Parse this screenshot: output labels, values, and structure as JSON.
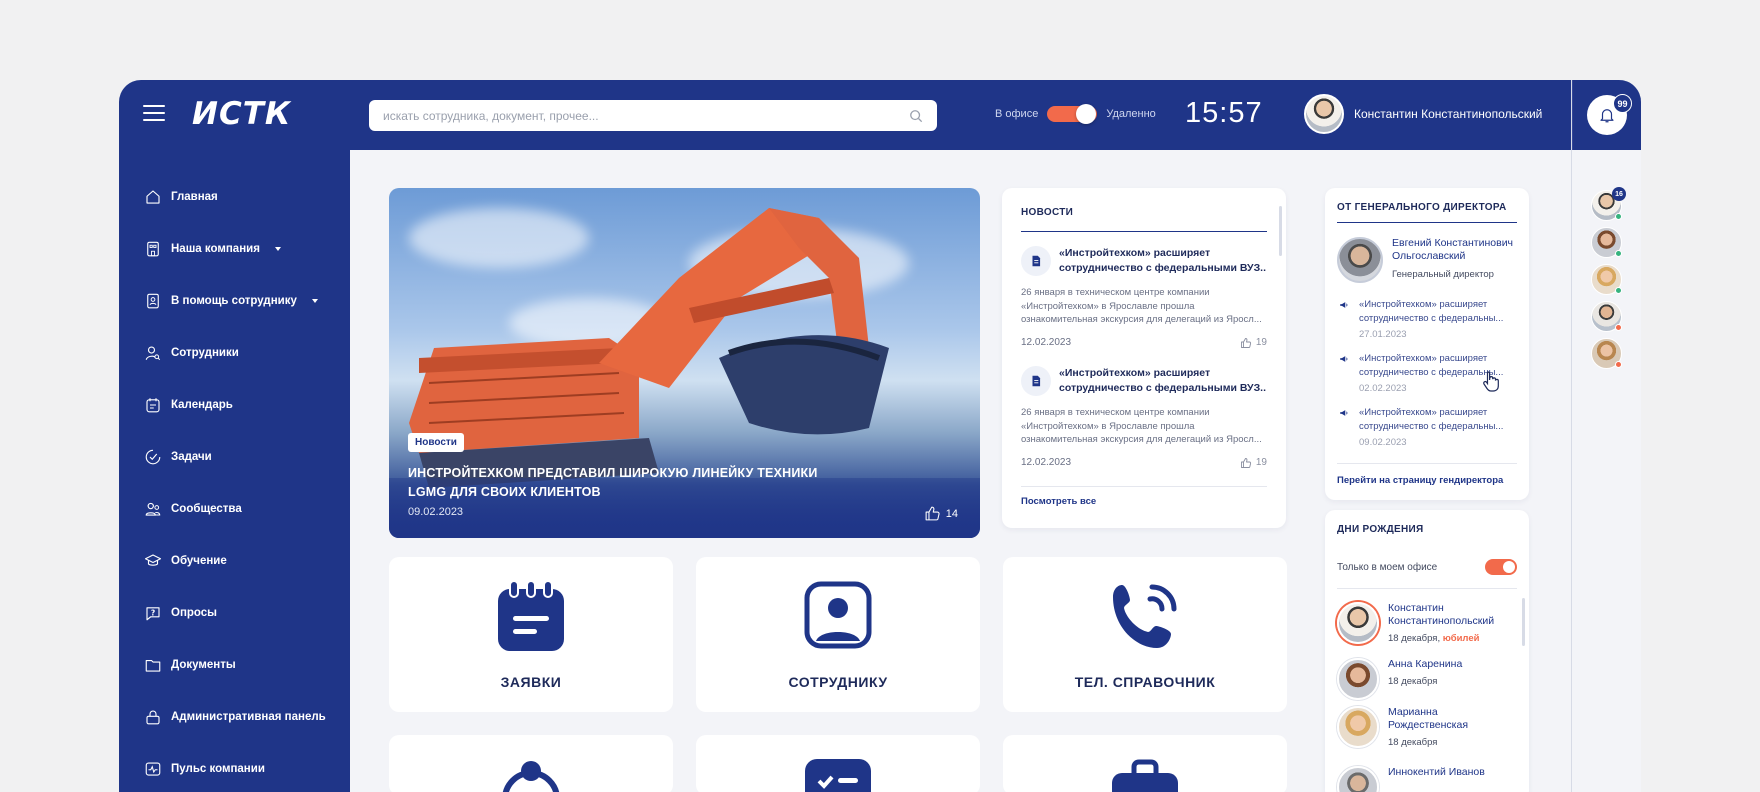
{
  "header": {
    "logo": "ИСТК",
    "search_placeholder": "искать сотрудника, документ, прочее...",
    "mode_office": "В офисе",
    "mode_remote": "Удаленно",
    "time": "15:57",
    "user_name": "Константин Константинопольский",
    "notifications_count": "99"
  },
  "sidebar": {
    "items": [
      {
        "label": "Главная",
        "icon": "home-icon"
      },
      {
        "label": "Наша компания",
        "icon": "building-icon",
        "dropdown": true
      },
      {
        "label": "В помощь сотруднику",
        "icon": "help-badge-icon",
        "dropdown": true
      },
      {
        "label": "Сотрудники",
        "icon": "user-search-icon"
      },
      {
        "label": "Календарь",
        "icon": "calendar-icon"
      },
      {
        "label": "Задачи",
        "icon": "tasks-icon"
      },
      {
        "label": "Сообщества",
        "icon": "community-icon"
      },
      {
        "label": "Обучение",
        "icon": "graduation-icon"
      },
      {
        "label": "Опросы",
        "icon": "poll-icon"
      },
      {
        "label": "Документы",
        "icon": "folder-icon"
      },
      {
        "label": "Административная панель",
        "icon": "lock-icon"
      },
      {
        "label": "Пульс компании",
        "icon": "pulse-icon"
      }
    ]
  },
  "hero": {
    "badge": "Новости",
    "title": "ИНСТРОЙТЕХКОМ ПРЕДСТАВИЛ ШИРОКУЮ ЛИНЕЙКУ ТЕХНИКИ LGMG ДЛЯ СВОИХ КЛИЕНТОВ",
    "date": "09.02.2023",
    "likes": "14"
  },
  "news": {
    "title": "НОВОСТИ",
    "items": [
      {
        "headline": "«Инстройтехком» расширяет сотрудничество с федеральными ВУЗ..",
        "body": "26 января в техническом центре компании «Инстройтехком» в Ярославле прошла ознакомительная экскурсия для делегаций из Яросл...",
        "date": "12.02.2023",
        "likes": "19"
      },
      {
        "headline": "«Инстройтехком» расширяет сотрудничество с федеральными ВУЗ..",
        "body": "26 января в техническом центре компании «Инстройтехком» в Ярославле прошла ознакомительная экскурсия для делегаций из Яросл...",
        "date": "12.02.2023",
        "likes": "19"
      }
    ],
    "view_all": "Посмотреть все"
  },
  "tiles": [
    {
      "label": "ЗАЯВКИ",
      "icon": "request-notepad-icon"
    },
    {
      "label": "СОТРУДНИКУ",
      "icon": "employee-portrait-icon"
    },
    {
      "label": "ТЕЛ. СПРАВОЧНИК",
      "icon": "phone-icon"
    }
  ],
  "director": {
    "title": "ОТ ГЕНЕРАЛЬНОГО ДИРЕКТОРА",
    "name": "Евгений Константинович Ольгославский",
    "role": "Генеральный директор",
    "messages": [
      {
        "text": "«Инстройтехком» расширяет сотрудничество с федеральны...",
        "date": "27.01.2023"
      },
      {
        "text": "«Инстройтехком» расширяет сотрудничество с федеральны...",
        "date": "02.02.2023"
      },
      {
        "text": "«Инстройтехком» расширяет сотрудничество с федеральны...",
        "date": "09.02.2023"
      }
    ],
    "link": "Перейти на страницу гендиректора"
  },
  "birthdays": {
    "title": "ДНИ РОЖДЕНИЯ",
    "filter_label": "Только в моем офисе",
    "items": [
      {
        "name": "Константин Константинопольский",
        "date": "18 декабря,",
        "tag": "юбилей"
      },
      {
        "name": "Анна Каренина",
        "date": "18 декабря",
        "tag": ""
      },
      {
        "name": "Марианна Рождественская",
        "date": "18 декабря",
        "tag": ""
      },
      {
        "name": "Иннокентий Иванов",
        "date": "",
        "tag": ""
      }
    ]
  },
  "right_rail": {
    "first_badge": "16"
  },
  "colors": {
    "primary": "#1f3588",
    "accent": "#f26a4b",
    "background": "#f3f4f8"
  }
}
